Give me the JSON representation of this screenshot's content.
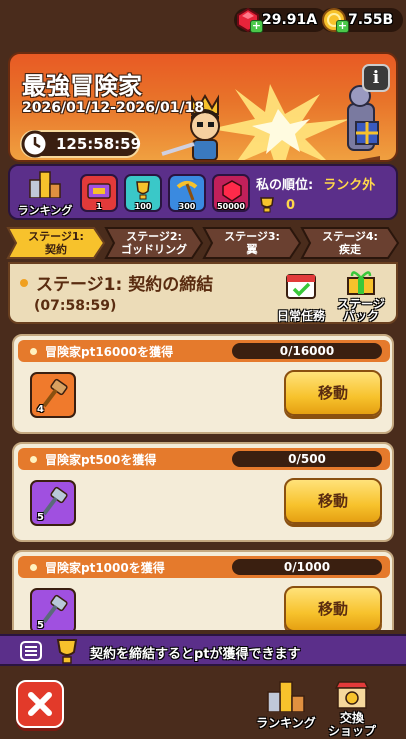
{
  "currency": {
    "gems": "29.91A",
    "coins": "7.55B"
  },
  "banner": {
    "title": "最強冒険家",
    "date_range": "2026/01/12-2026/01/18",
    "timer": "125:58:59"
  },
  "ranking": {
    "button_label": "ランキング",
    "rewards": [
      {
        "icon": "ticket-icon",
        "count": "1",
        "color": "#e23a3a"
      },
      {
        "icon": "trophy-icon",
        "count": "100",
        "color": "#3ac8c8"
      },
      {
        "icon": "pickaxe-icon",
        "count": "300",
        "color": "#3a8ae0"
      },
      {
        "icon": "ruby-icon",
        "count": "50000",
        "color": "#e23a6a"
      }
    ],
    "my_rank_label": "私の順位:",
    "my_rank_value": "ランク外",
    "my_points": "0"
  },
  "tabs": [
    {
      "line1": "ステージ1:",
      "line2": "契約"
    },
    {
      "line1": "ステージ2:",
      "line2": "ゴッドリング"
    },
    {
      "line1": "ステージ3:",
      "line2": "翼"
    },
    {
      "line1": "ステージ4:",
      "line2": "疾走"
    }
  ],
  "stage": {
    "title": "ステージ1:  契約の締結",
    "time": "(07:58:59)",
    "daily_label": "日常任務",
    "pack_label_1": "ステージ",
    "pack_label_2": "パック"
  },
  "quests": [
    {
      "title": "冒険家pt16000を獲得",
      "progress": "0/16000",
      "item_count": "4",
      "item_color": "#f07a2c",
      "button": "移動"
    },
    {
      "title": "冒険家pt500を獲得",
      "progress": "0/500",
      "item_count": "5",
      "item_color": "#a050e0",
      "button": "移動"
    },
    {
      "title": "冒険家pt1000を獲得",
      "progress": "0/1000",
      "item_count": "5",
      "item_color": "#a050e0",
      "button": "移動"
    }
  ],
  "notice": "契約を締結するとptが獲得できます",
  "bottom": {
    "ranking_label": "ランキング",
    "shop_label_1": "交換",
    "shop_label_2": "ショップ"
  }
}
